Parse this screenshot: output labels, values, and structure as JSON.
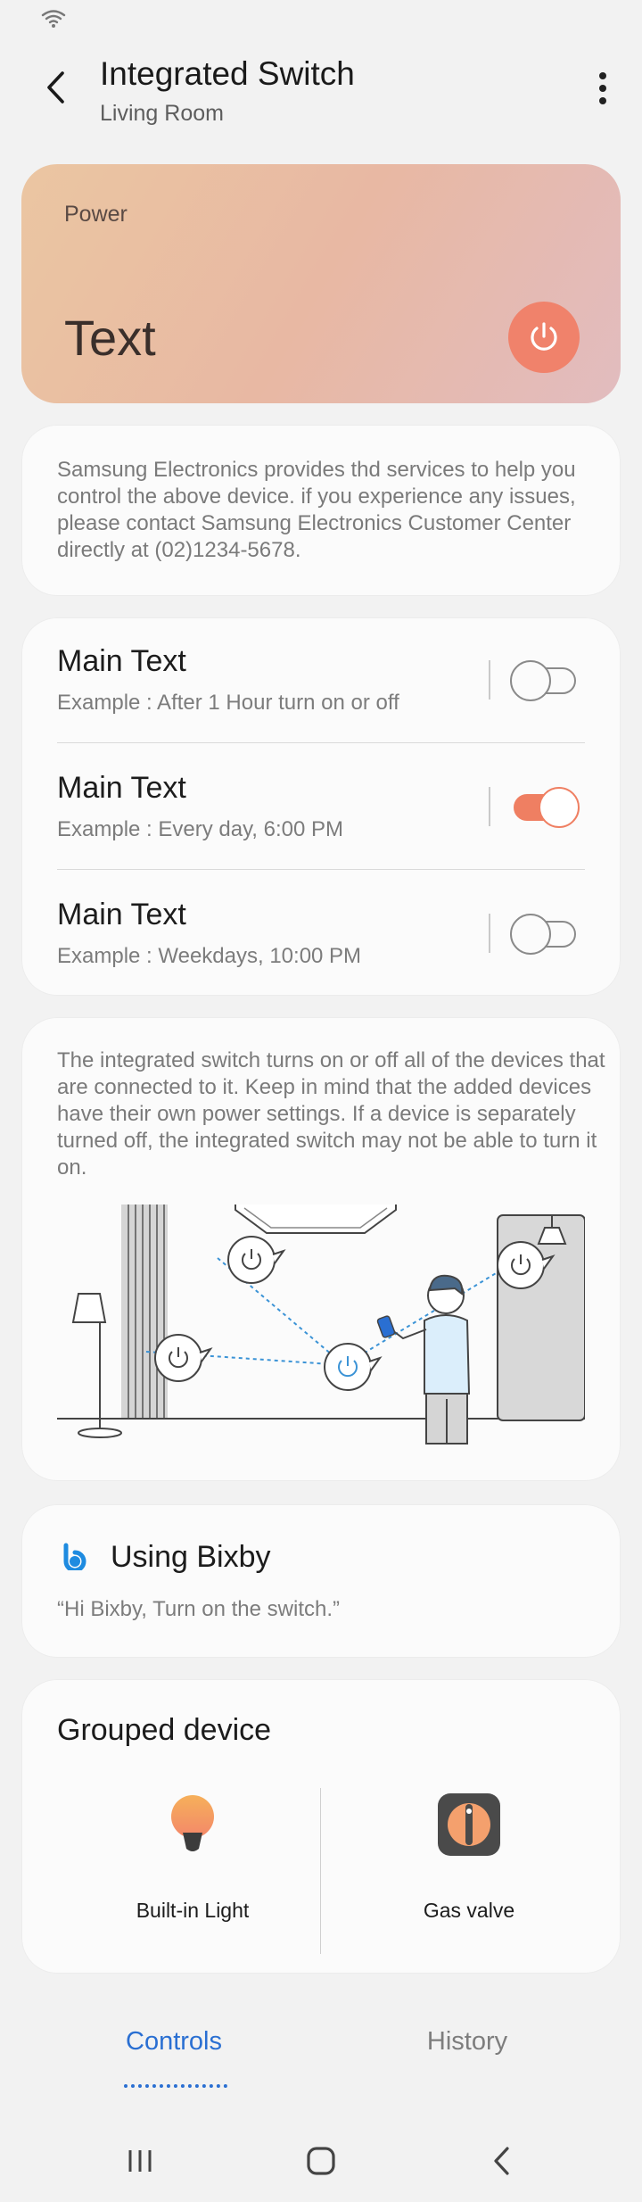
{
  "header": {
    "title": "Integrated Switch",
    "subtitle": "Living Room"
  },
  "power": {
    "label": "Power",
    "value": "Text",
    "button_color": "#f0826b"
  },
  "notice": {
    "text": "Samsung Electronics provides thd services to help you control the above device. if you experience any issues, please contact Samsung Electronics Customer Center directly at (02)1234-5678."
  },
  "schedules": [
    {
      "main": "Main Text",
      "sub": "Example : After 1 Hour turn on or off",
      "enabled": false
    },
    {
      "main": "Main Text",
      "sub": "Example : Every day, 6:00 PM",
      "enabled": true
    },
    {
      "main": "Main Text",
      "sub": "Example : Weekdays, 10:00 PM",
      "enabled": false
    }
  ],
  "description": {
    "text": "The integrated switch turns on or off all of the devices that are connected to it. Keep in mind that the added devices have their own power settings. If a device is separately turned off, the integrated switch may not be able to turn it on."
  },
  "bixby": {
    "title": "Using Bixby",
    "hint": "“Hi Bixby, Turn on the switch.”"
  },
  "grouped": {
    "title": "Grouped device",
    "devices": [
      {
        "name": "Built-in Light",
        "icon": "light-bulb-icon"
      },
      {
        "name": "Gas valve",
        "icon": "gas-valve-icon"
      }
    ]
  },
  "tabs": {
    "controls": "Controls",
    "history": "History",
    "active": "Controls",
    "accent": "#2a6fd2"
  },
  "navbar": {
    "recents": "recents-icon",
    "home": "home-icon",
    "back": "back-icon"
  }
}
